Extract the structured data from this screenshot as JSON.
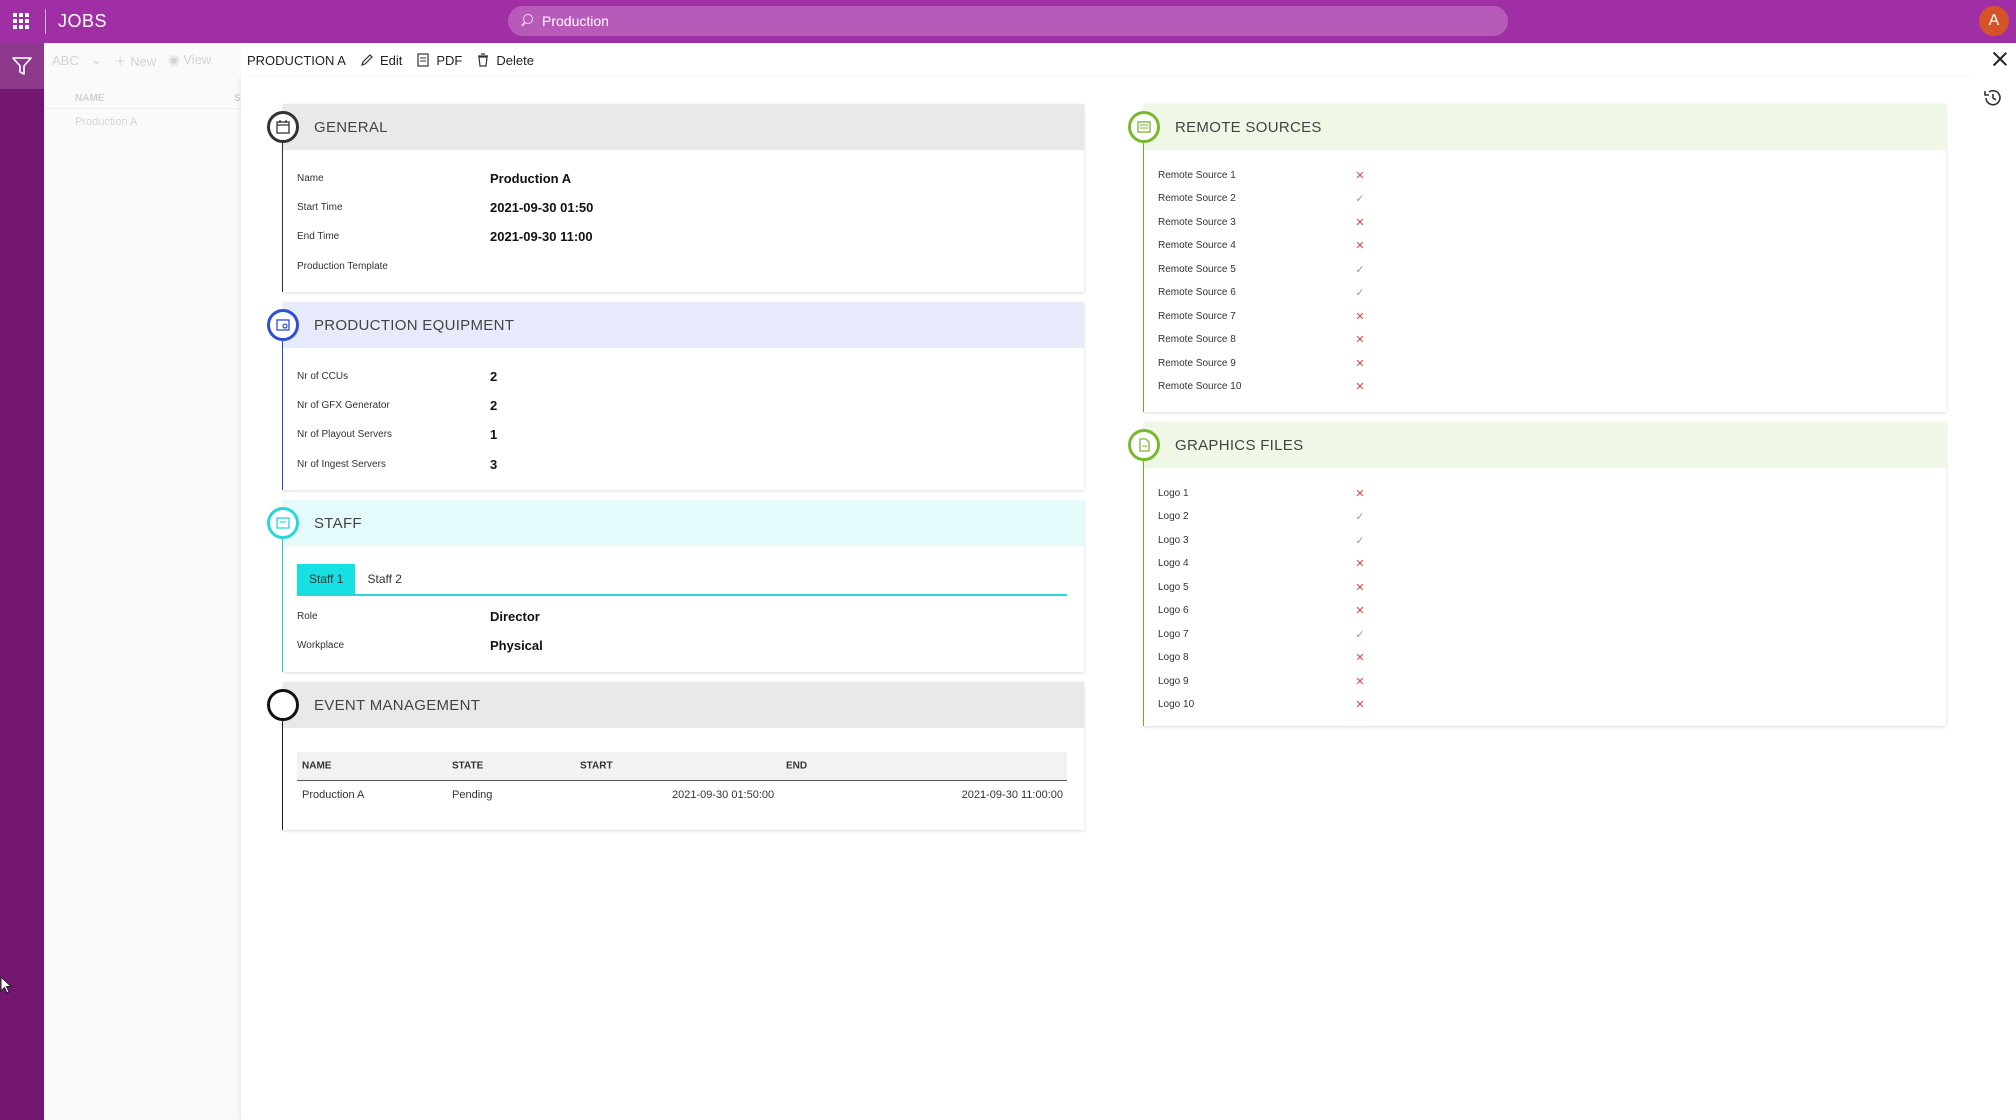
{
  "topbar": {
    "app_title": "JOBS",
    "search_value": "Production",
    "avatar_initial": "A"
  },
  "list_pane": {
    "toolbar": {
      "abc": "ABC",
      "new": "New",
      "view": "View"
    },
    "column_name": "NAME",
    "column_s": "S",
    "row": "Production A"
  },
  "detail_toolbar": {
    "title": "PRODUCTION A",
    "edit": "Edit",
    "pdf": "PDF",
    "delete": "Delete"
  },
  "general": {
    "title": "GENERAL",
    "rows": [
      {
        "label": "Name",
        "value": "Production A"
      },
      {
        "label": "Start Time",
        "value": "2021-09-30 01:50"
      },
      {
        "label": "End Time",
        "value": "2021-09-30 11:00"
      },
      {
        "label": "Production Template",
        "value": ""
      }
    ]
  },
  "equipment": {
    "title": "PRODUCTION EQUIPMENT",
    "rows": [
      {
        "label": "Nr of CCUs",
        "value": "2"
      },
      {
        "label": "Nr of GFX Generator",
        "value": "2"
      },
      {
        "label": "Nr of Playout Servers",
        "value": "1"
      },
      {
        "label": "Nr of Ingest Servers",
        "value": "3"
      }
    ]
  },
  "staff": {
    "title": "STAFF",
    "tabs": [
      "Staff 1",
      "Staff 2"
    ],
    "rows": [
      {
        "label": "Role",
        "value": "Director"
      },
      {
        "label": "Workplace",
        "value": "Physical"
      }
    ]
  },
  "events": {
    "title": "EVENT MANAGEMENT",
    "headers": {
      "name": "NAME",
      "state": "STATE",
      "start": "START",
      "end": "END"
    },
    "rows": [
      {
        "name": "Production A",
        "state": "Pending",
        "start": "2021-09-30 01:50:00",
        "end": "2021-09-30 11:00:00"
      }
    ]
  },
  "remote_sources": {
    "title": "REMOTE SOURCES",
    "items": [
      {
        "label": "Remote Source 1",
        "ok": false
      },
      {
        "label": "Remote Source 2",
        "ok": true
      },
      {
        "label": "Remote Source 3",
        "ok": false
      },
      {
        "label": "Remote Source 4",
        "ok": false
      },
      {
        "label": "Remote Source 5",
        "ok": true
      },
      {
        "label": "Remote Source 6",
        "ok": true
      },
      {
        "label": "Remote Source 7",
        "ok": false
      },
      {
        "label": "Remote Source 8",
        "ok": false
      },
      {
        "label": "Remote Source 9",
        "ok": false
      },
      {
        "label": "Remote Source 10",
        "ok": false
      }
    ]
  },
  "graphics_files": {
    "title": "GRAPHICS FILES",
    "items": [
      {
        "label": "Logo 1",
        "ok": false
      },
      {
        "label": "Logo 2",
        "ok": true
      },
      {
        "label": "Logo 3",
        "ok": true
      },
      {
        "label": "Logo 4",
        "ok": false
      },
      {
        "label": "Logo 5",
        "ok": false
      },
      {
        "label": "Logo 6",
        "ok": false
      },
      {
        "label": "Logo 7",
        "ok": true
      },
      {
        "label": "Logo 8",
        "ok": false
      },
      {
        "label": "Logo 9",
        "ok": false
      },
      {
        "label": "Logo 10",
        "ok": false
      }
    ]
  },
  "colors": {
    "topbar": "#a02fa5",
    "rail": "#74166f",
    "general_accent": "#333333",
    "equipment_accent": "#2d4fd3",
    "staff_accent": "#2ad7d8",
    "events_accent": "#222222",
    "remote_accent": "#7ab82e",
    "status_x": "#e0463f"
  }
}
